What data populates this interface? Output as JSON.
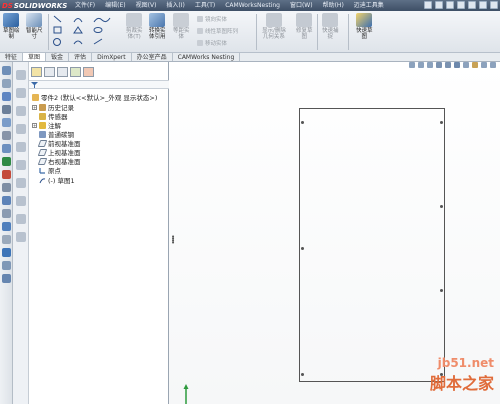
{
  "app": {
    "logo_ds": "DS",
    "logo_name": "SOLIDWORKS"
  },
  "menu": [
    "文件(F)",
    "编辑(E)",
    "视图(V)",
    "插入(I)",
    "工具(T)",
    "CAMWorksNesting",
    "窗口(W)",
    "帮助(H)",
    "迈迪工具集"
  ],
  "ribbon": {
    "exit_sketch": "草图绘\n制",
    "smart_dim": "智能尺\n寸",
    "trim": "剪裁实\n体(T)",
    "convert": "转换实\n体引用",
    "offset": "等距实\n体",
    "mirror": "镜向实体",
    "linear_pattern": "线性草图阵列",
    "move": "移动实体",
    "display_relations": "显示/删除\n几何关系",
    "repair": "修复草\n图",
    "quick_snaps": "快速捕\n捉",
    "rapid_sketch": "快速草\n图"
  },
  "tabs": [
    "特征",
    "草图",
    "钣金",
    "评估",
    "DimXpert",
    "办公室产品",
    "CAMWorks Nesting"
  ],
  "active_tab": "草图",
  "tree": {
    "root": "零件2 (默认<<默认>_外观 显示状态>)",
    "nodes": [
      "历史记录",
      "传感器",
      "注解",
      "普通碳钢",
      "前视基准面",
      "上视基准面",
      "右视基准面",
      "原点",
      "(-) 草图1"
    ]
  },
  "watermark": {
    "url": "jb51.net",
    "text": "脚本之家"
  },
  "colors": {
    "title_bg": "#4a5b72",
    "accent": "#e06c3a"
  }
}
